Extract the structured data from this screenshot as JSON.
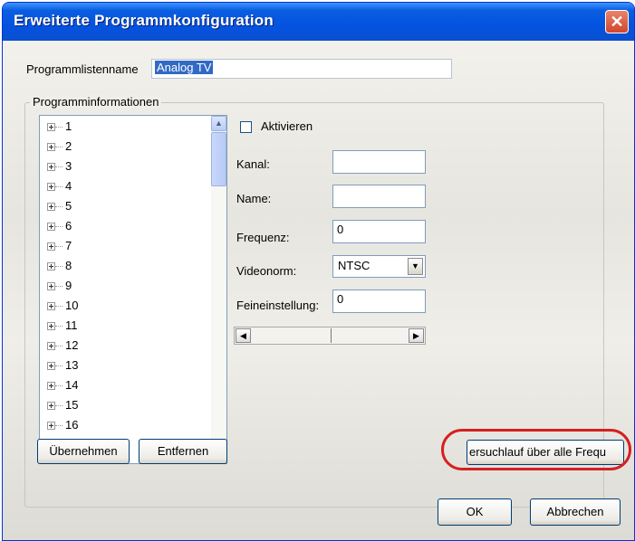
{
  "window": {
    "title": "Erweiterte Programmkonfiguration",
    "close_icon": "close-icon",
    "accent": "#0a5ee0",
    "close_color": "#d1462c"
  },
  "programlist": {
    "label": "Programmlistenname",
    "value": "Analog TV"
  },
  "group": {
    "legend": "Programminformationen"
  },
  "tree": {
    "items": [
      "1",
      "2",
      "3",
      "4",
      "5",
      "6",
      "7",
      "8",
      "9",
      "10",
      "11",
      "12",
      "13",
      "14",
      "15",
      "16"
    ]
  },
  "form": {
    "activate_label": "Aktivieren",
    "activate_checked": false,
    "channel_label": "Kanal:",
    "channel_value": "",
    "name_label": "Name:",
    "name_value": "",
    "frequency_label": "Frequenz:",
    "frequency_value": "0",
    "videonorm_label": "Videonorm:",
    "videonorm_value": "NTSC",
    "finetune_label": "Feineinstellung:",
    "finetune_value": "0",
    "slider_level": 0.55
  },
  "buttons": {
    "apply": "Übernehmen",
    "remove": "Entfernen",
    "scan_all": "ersuchlauf über alle Frequ",
    "ok": "OK",
    "cancel": "Abbrechen"
  },
  "annotation": {
    "highlight_color": "#d61f1f"
  }
}
